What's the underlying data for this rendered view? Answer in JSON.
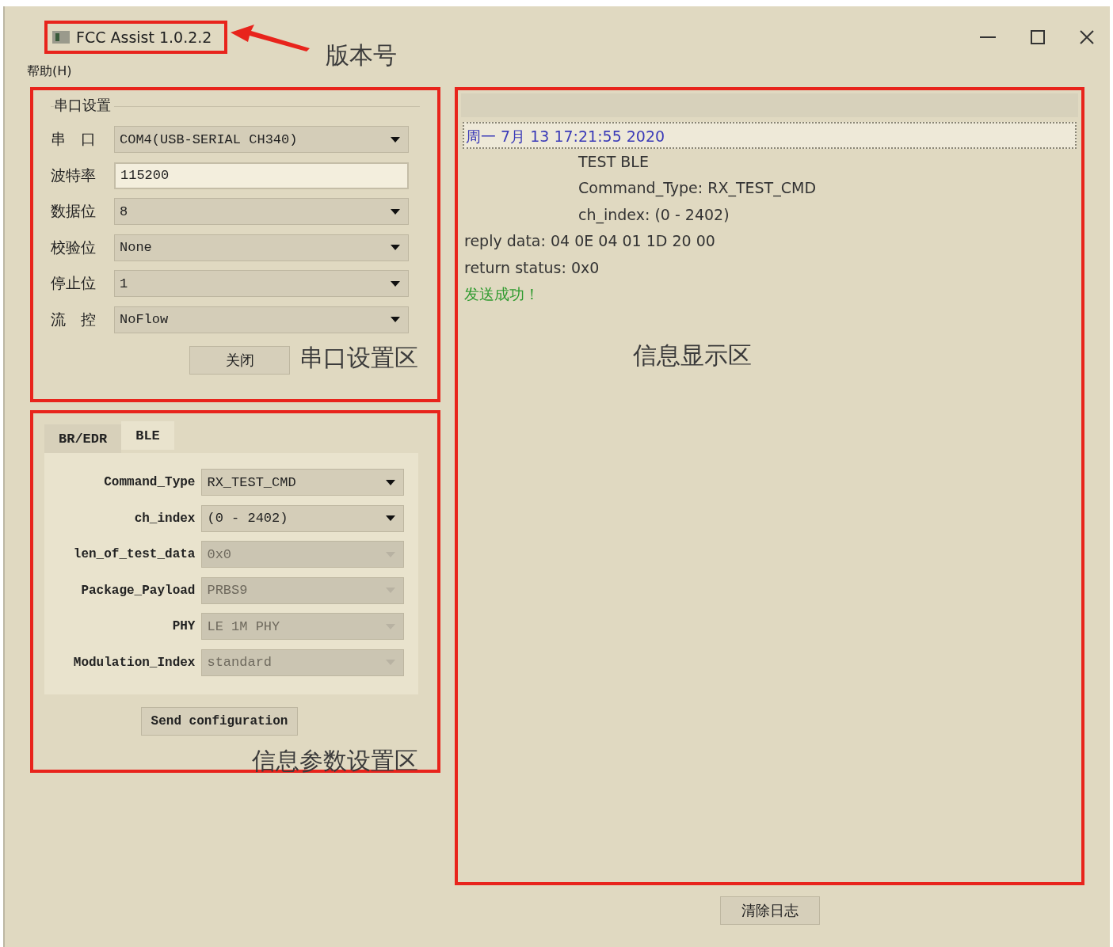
{
  "window": {
    "title": "FCC Assist 1.0.2.2"
  },
  "annotations": {
    "version": "版本号",
    "serial_area": "串口设置区",
    "params_area": "信息参数设置区",
    "display_area": "信息显示区"
  },
  "menu": [
    {
      "label": "帮助(H)"
    }
  ],
  "serial_settings": {
    "title": "串口设置",
    "fields": [
      {
        "label": "串　口",
        "kind": "select",
        "value": "COM4(USB-SERIAL CH340)"
      },
      {
        "label": "波特率",
        "kind": "input",
        "value": "115200"
      },
      {
        "label": "数据位",
        "kind": "select",
        "value": "8"
      },
      {
        "label": "校验位",
        "kind": "select",
        "value": "None"
      },
      {
        "label": "停止位",
        "kind": "select",
        "value": "1"
      },
      {
        "label": "流　控",
        "kind": "select",
        "value": "NoFlow"
      }
    ],
    "button": "关闭"
  },
  "params": {
    "tabs": [
      {
        "label": "BR/EDR",
        "selected": false
      },
      {
        "label": "BLE",
        "selected": true
      }
    ],
    "fields": [
      {
        "label": "Command_Type",
        "value": "RX_TEST_CMD",
        "disabled": false
      },
      {
        "label": "ch_index",
        "value": "(0 - 2402)",
        "disabled": false
      },
      {
        "label": "len_of_test_data",
        "value": "0x0",
        "disabled": true
      },
      {
        "label": "Package_Payload",
        "value": "PRBS9",
        "disabled": true
      },
      {
        "label": "PHY",
        "value": "LE 1M PHY",
        "disabled": true
      },
      {
        "label": "Modulation_Index",
        "value": "standard",
        "disabled": true
      }
    ],
    "button": "Send configuration"
  },
  "log": {
    "lines": [
      {
        "kind": "timestamp",
        "text": "周一 7月 13 17:21:55 2020"
      },
      {
        "kind": "indented",
        "text": "TEST BLE"
      },
      {
        "kind": "indented",
        "text": "Command_Type: RX_TEST_CMD"
      },
      {
        "kind": "indented",
        "text": "ch_index: (0 - 2402)"
      },
      {
        "kind": "plain",
        "text": "reply data: 04 0E 04 01 1D 20 00"
      },
      {
        "kind": "plain",
        "text": "return status: 0x0"
      },
      {
        "kind": "success",
        "text": "发送成功！"
      }
    ]
  },
  "clear_button": "清除日志"
}
